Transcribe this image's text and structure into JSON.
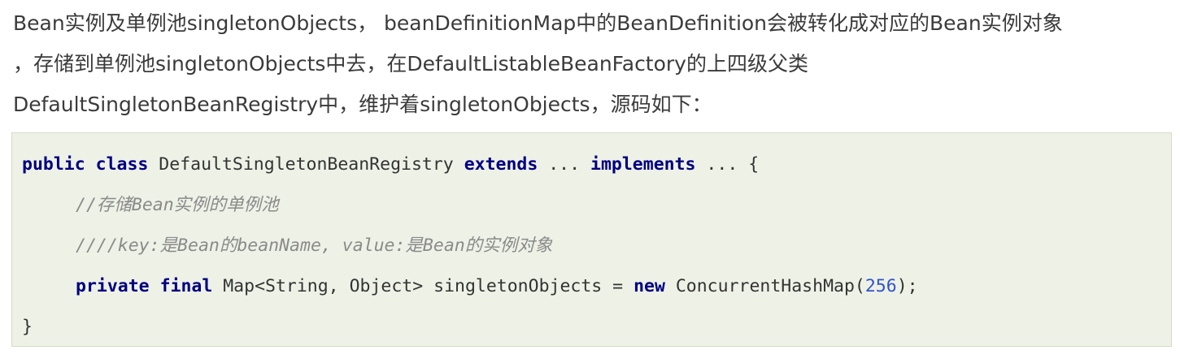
{
  "prose": {
    "line1": "Bean实例及单例池singletonObjects， beanDefinitionMap中的BeanDefinition会被转化成对应的Bean实例对象",
    "line2": "，存储到单例池singletonObjects中去，在DefaultListableBeanFactory的上四级父类",
    "line3": "DefaultSingletonBeanRegistry中，维护着singletonObjects，源码如下："
  },
  "code": {
    "line1": {
      "kw_public": "public",
      "kw_class": "class",
      "class_name": " DefaultSingletonBeanRegistry ",
      "kw_extends": "extends",
      "ellipsis1": " ... ",
      "kw_implements": "implements",
      "tail": " ... {"
    },
    "line2": {
      "comment": "//存储Bean实例的单例池"
    },
    "line3": {
      "comment": "////key:是Bean的beanName, value:是Bean的实例对象"
    },
    "line4": {
      "kw_private": "private",
      "kw_final": "final",
      "decl": " Map<String, Object> singletonObjects = ",
      "kw_new": "new",
      "ctor": " ConcurrentHashMap(",
      "number": "256",
      "end": ");"
    },
    "line5": {
      "close": "}"
    }
  },
  "colors": {
    "keyword": "#000080",
    "comment": "#8a8a8a",
    "number": "#2f55c8",
    "code_background": "#eef1e6"
  }
}
